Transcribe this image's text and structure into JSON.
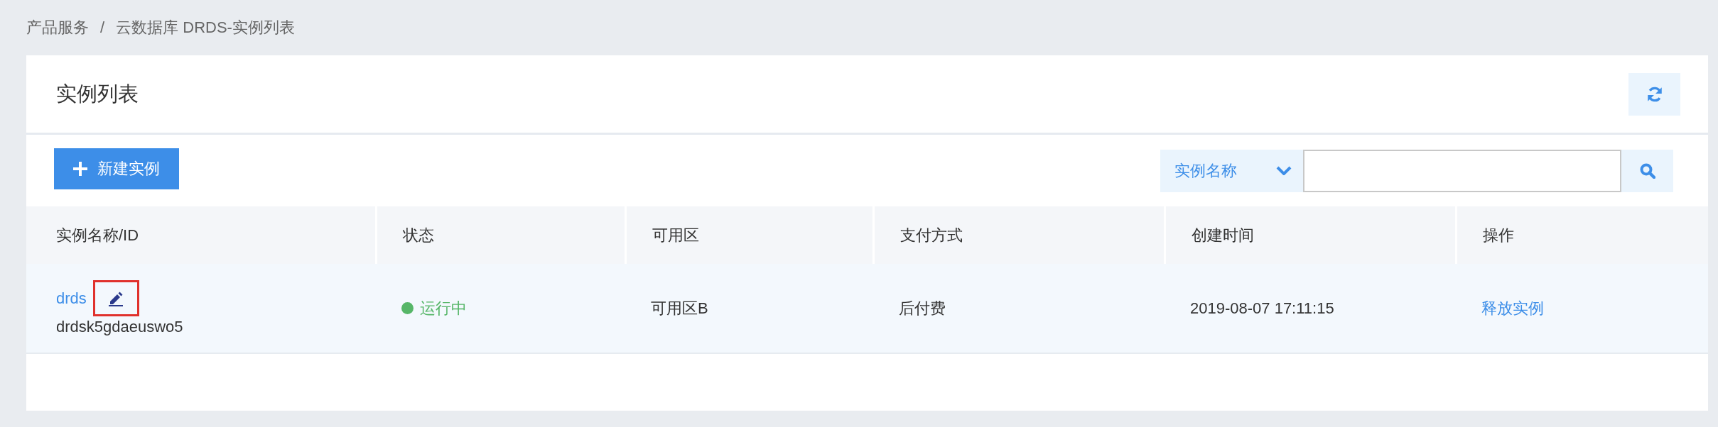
{
  "breadcrumb": {
    "items": [
      "产品服务",
      "云数据库 DRDS-实例列表"
    ],
    "separator": "/"
  },
  "panel": {
    "title": "实例列表"
  },
  "toolbar": {
    "create_button": "新建实例",
    "filter": {
      "field": "实例名称"
    }
  },
  "table": {
    "columns": [
      "实例名称/ID",
      "状态",
      "可用区",
      "支付方式",
      "创建时间",
      "操作"
    ],
    "rows": [
      {
        "name": "drds",
        "id": "drdsk5gdaeuswo5",
        "edit_annotated": true,
        "hovered": true,
        "status": {
          "label": "运行中",
          "color": "#56b668"
        },
        "zone": "可用区B",
        "payment": "后付费",
        "created": "2019-08-07 17:11:15",
        "action": "释放实例"
      }
    ]
  }
}
